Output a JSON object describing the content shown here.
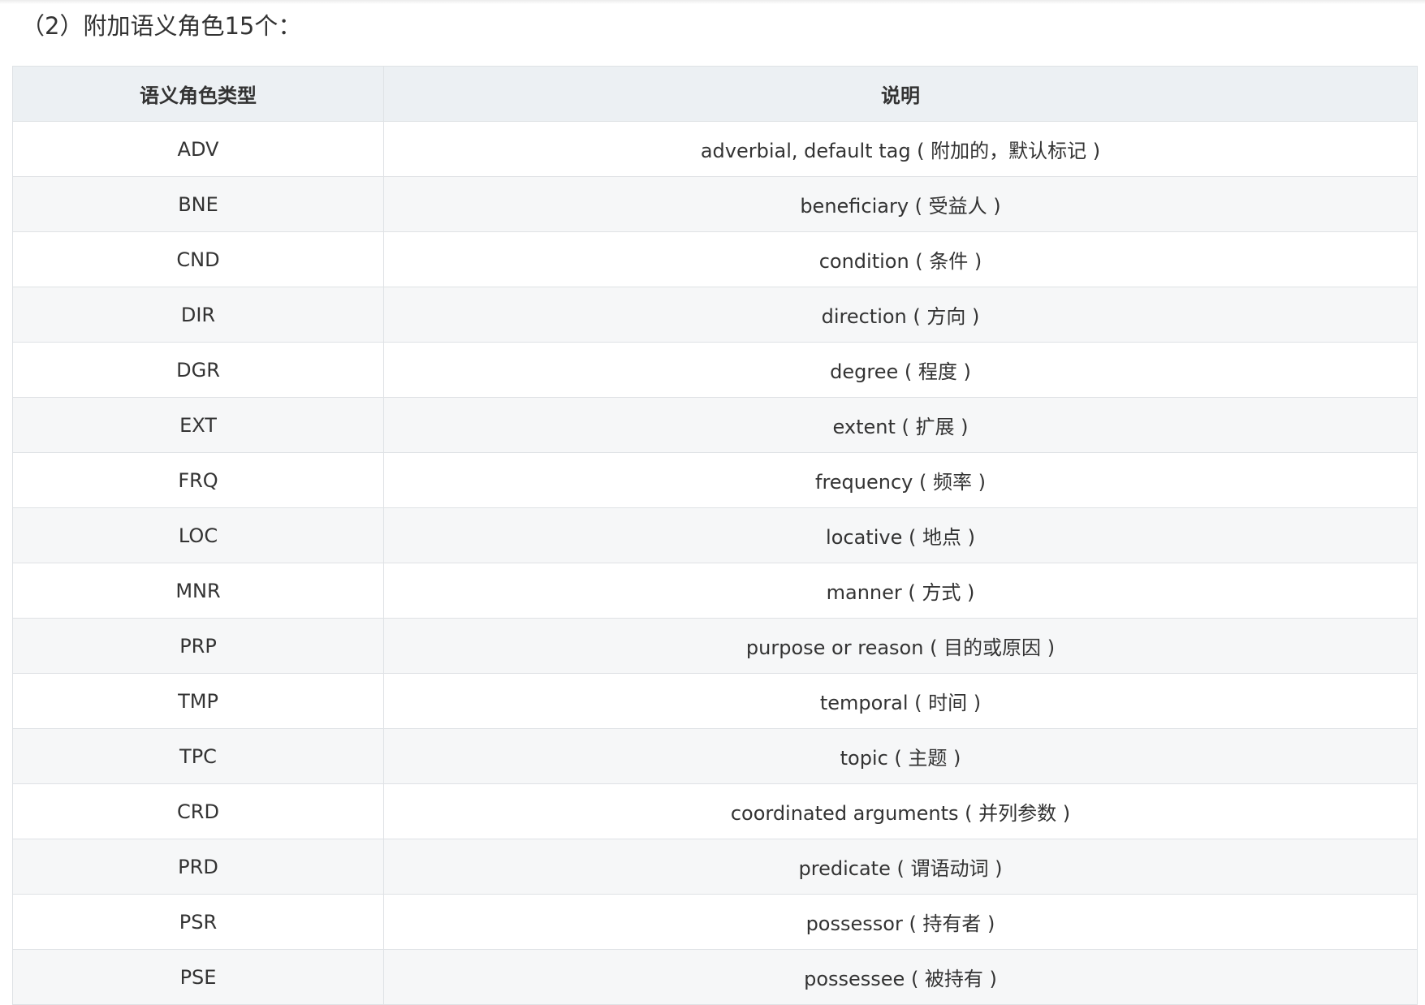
{
  "heading": "（2）附加语义角色15个：",
  "table": {
    "headers": [
      "语义角色类型",
      "说明"
    ],
    "rows": [
      {
        "code": "ADV",
        "desc": "adverbial, default tag ( 附加的，默认标记 )"
      },
      {
        "code": "BNE",
        "desc": "beneficiary ( 受益人 )"
      },
      {
        "code": "CND",
        "desc": "condition ( 条件 )"
      },
      {
        "code": "DIR",
        "desc": "direction ( 方向 )"
      },
      {
        "code": "DGR",
        "desc": "degree ( 程度 )"
      },
      {
        "code": "EXT",
        "desc": "extent ( 扩展 )"
      },
      {
        "code": "FRQ",
        "desc": "frequency ( 频率 )"
      },
      {
        "code": "LOC",
        "desc": "locative ( 地点 )"
      },
      {
        "code": "MNR",
        "desc": "manner ( 方式 )"
      },
      {
        "code": "PRP",
        "desc": "purpose or reason ( 目的或原因 )"
      },
      {
        "code": "TMP",
        "desc": "temporal ( 时间 )"
      },
      {
        "code": "TPC",
        "desc": "topic ( 主题 )"
      },
      {
        "code": "CRD",
        "desc": "coordinated arguments ( 并列参数 )"
      },
      {
        "code": "PRD",
        "desc": "predicate ( 谓语动词 )"
      },
      {
        "code": "PSR",
        "desc": "possessor ( 持有者 )"
      },
      {
        "code": "PSE",
        "desc": "possessee ( 被持有 )"
      }
    ]
  }
}
